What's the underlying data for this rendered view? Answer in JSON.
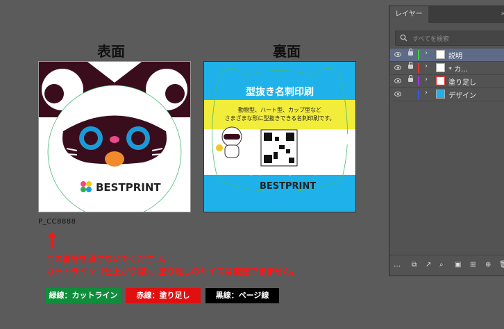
{
  "canvas": {
    "front_title": "表面",
    "back_title": "裏面",
    "product_code": "P_CC8888"
  },
  "front_card": {
    "brand": "BESTPRINT"
  },
  "back_card": {
    "headline": "型抜き名刺印刷",
    "line1": "動物型、ハート型、カップ型など",
    "line2": "さまざまな形に型抜きできる名刺印刷です。",
    "url": "https://www.bestprints.biz/",
    "brand": "BESTPRINT",
    "colors": {
      "sky": "#1fb1ea",
      "band": "#f2ec3a"
    }
  },
  "instructions": {
    "line1": "この番号を消さないでください。",
    "line2": "カットライン（仕上がり線）、塗り足しのサイズは変更できません。"
  },
  "legend": [
    {
      "label": "緑線：カットライン",
      "color": "#0f8d3b"
    },
    {
      "label": "赤線：塗り足し",
      "color": "#e01010"
    },
    {
      "label": "黒線：ページ線",
      "color": "#000000"
    }
  ],
  "layers_panel": {
    "tab": "レイヤー",
    "search_placeholder": "すべてを検索",
    "layers": [
      {
        "name": "説明",
        "color": "#3fd13f",
        "selected": true
      },
      {
        "name": "* カ...",
        "color": "#e83232",
        "selected": false
      },
      {
        "name": "塗り足し",
        "color": "#9b3ad6",
        "selected": false
      },
      {
        "name": "デザイン",
        "color": "#3a5ad6",
        "selected": false
      }
    ]
  }
}
